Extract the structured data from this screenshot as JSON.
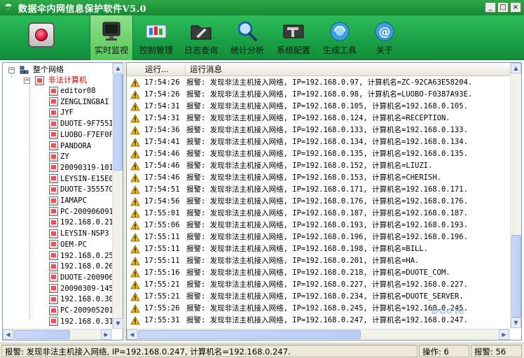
{
  "window": {
    "title": "数据伞内网信息保护软件V5.0",
    "minimize_glyph": "_",
    "maximize_glyph": "□",
    "close_glyph": "×"
  },
  "toolbar": {
    "items": [
      {
        "label": "实时监视",
        "icon": "monitor-icon",
        "active": true
      },
      {
        "label": "控制管理",
        "icon": "control-icon",
        "active": false
      },
      {
        "label": "日志查询",
        "icon": "log-folder-icon",
        "active": false
      },
      {
        "label": "统计分析",
        "icon": "magnifier-icon",
        "active": false
      },
      {
        "label": "系统配置",
        "icon": "config-tools-icon",
        "active": false
      },
      {
        "label": "生成工具",
        "icon": "generate-disc-icon",
        "active": false
      },
      {
        "label": "关于",
        "icon": "about-at-icon",
        "active": false
      }
    ],
    "power_icon": "power-button-icon"
  },
  "tree": {
    "root_label": "整个网络",
    "group_label": "非法计算机",
    "group_color": "#d00000",
    "items": [
      "editor08",
      "ZENGLINGBAI",
      "JYF",
      "DUOTE-9F755I",
      "LUOBO-F7EF0F",
      "PANDORA",
      "ZY",
      "20090319-101",
      "LEYSIN-E15E0",
      "DUOTE-35557C",
      "IAMAPC",
      "PC-200906091",
      "192.168.0.21",
      "LEYSIN-NSP3",
      "OEM-PC",
      "192.168.0.25",
      "192.168.0.26",
      "DUOTE-200906",
      "20090309-145",
      "192.168.0.30",
      "PC-200905201",
      "192.168.0.31"
    ]
  },
  "log": {
    "columns": [
      "运行...",
      "运行消息"
    ],
    "rows": [
      {
        "time": "17:54:26",
        "message": "报警: 发现非法主机接入网络, IP=192.168.0.97, 计算机名=ZC-92CA63E58204."
      },
      {
        "time": "17:54:26",
        "message": "报警: 发现非法主机接入网络, IP=192.168.0.98, 计算机名=LUOBO-F0387A93E."
      },
      {
        "time": "17:54:31",
        "message": "报警: 发现非法主机接入网络, IP=192.168.0.105, 计算机名=192.168.0.105."
      },
      {
        "time": "17:54:31",
        "message": "报警: 发现非法主机接入网络, IP=192.168.0.124, 计算机名=RECEPTION."
      },
      {
        "time": "17:54:36",
        "message": "报警: 发现非法主机接入网络, IP=192.168.0.133, 计算机名=192.168.0.133."
      },
      {
        "time": "17:54:41",
        "message": "报警: 发现非法主机接入网络, IP=192.168.0.134, 计算机名=192.168.0.134."
      },
      {
        "time": "17:54:46",
        "message": "报警: 发现非法主机接入网络, IP=192.168.0.135, 计算机名=192.168.0.135."
      },
      {
        "time": "17:54:46",
        "message": "报警: 发现非法主机接入网络, IP=192.168.0.152, 计算机名=LIUZI."
      },
      {
        "time": "17:54:46",
        "message": "报警: 发现非法主机接入网络, IP=192.168.0.153, 计算机名=CHERISH."
      },
      {
        "time": "17:54:51",
        "message": "报警: 发现非法主机接入网络, IP=192.168.0.171, 计算机名=192.168.0.171."
      },
      {
        "time": "17:54:56",
        "message": "报警: 发现非法主机接入网络, IP=192.168.0.176, 计算机名=192.168.0.176."
      },
      {
        "time": "17:55:01",
        "message": "报警: 发现非法主机接入网络, IP=192.168.0.187, 计算机名=192.168.0.187."
      },
      {
        "time": "17:55:06",
        "message": "报警: 发现非法主机接入网络, IP=192.168.0.193, 计算机名=192.168.0.193."
      },
      {
        "time": "17:55:11",
        "message": "报警: 发现非法主机接入网络, IP=192.168.0.196, 计算机名=192.168.0.196."
      },
      {
        "time": "17:55:11",
        "message": "报警: 发现非法主机接入网络, IP=192.168.0.198, 计算机名=BILL."
      },
      {
        "time": "17:55:11",
        "message": "报警: 发现非法主机接入网络, IP=192.168.0.201, 计算机名=HA."
      },
      {
        "time": "17:55:16",
        "message": "报警: 发现非法主机接入网络, IP=192.168.0.218, 计算机名=DUOTE_COM."
      },
      {
        "time": "17:55:21",
        "message": "报警: 发现非法主机接入网络, IP=192.168.0.227, 计算机名=192.168.0.227."
      },
      {
        "time": "17:55:21",
        "message": "报警: 发现非法主机接入网络, IP=192.168.0.234, 计算机名=DUOTE_SERVER."
      },
      {
        "time": "17:55:26",
        "message": "报警: 发现非法主机接入网络, IP=192.168.0.245, 计算机名=192.168.0.245."
      },
      {
        "time": "17:55:31",
        "message": "报警: 发现非法主机接入网络, IP=192.168.0.247, 计算机名=192.168.0.247."
      }
    ]
  },
  "status": {
    "message": "报警: 发现非法主机接入网络, IP=192.168.0.247, 计算机名=192.168.0.247.",
    "operations": "操作: 6",
    "alarms": "报警: 56"
  },
  "watermark": {
    "text": "DuoTe"
  },
  "colors": {
    "toolbar_green": "#19a046",
    "warning_yellow": "#f3b800",
    "alert_red": "#d00000"
  }
}
